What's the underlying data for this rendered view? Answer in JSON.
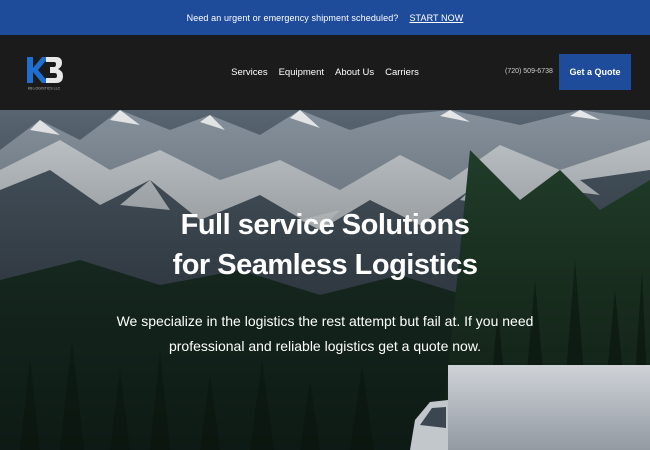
{
  "announcement": {
    "message": "Need an urgent or emergency shipment scheduled?",
    "cta": "START NOW"
  },
  "header": {
    "logo_text": "KB",
    "logo_sub": "KB LOGISTICS LLC",
    "nav": [
      "Services",
      "Equipment",
      "About Us",
      "Carriers"
    ],
    "phone": "(720) 509-6738",
    "quote_button": "Get a Quote"
  },
  "hero": {
    "title_line1": "Full service Solutions",
    "title_line2": "for Seamless Logistics",
    "sub_line1": "We specialize in the logistics the rest attempt but fail at. If you need",
    "sub_line2": "professional and reliable logistics get a quote now."
  },
  "colors": {
    "accent": "#1e4b9a",
    "header_bg": "#1b1b1b"
  }
}
